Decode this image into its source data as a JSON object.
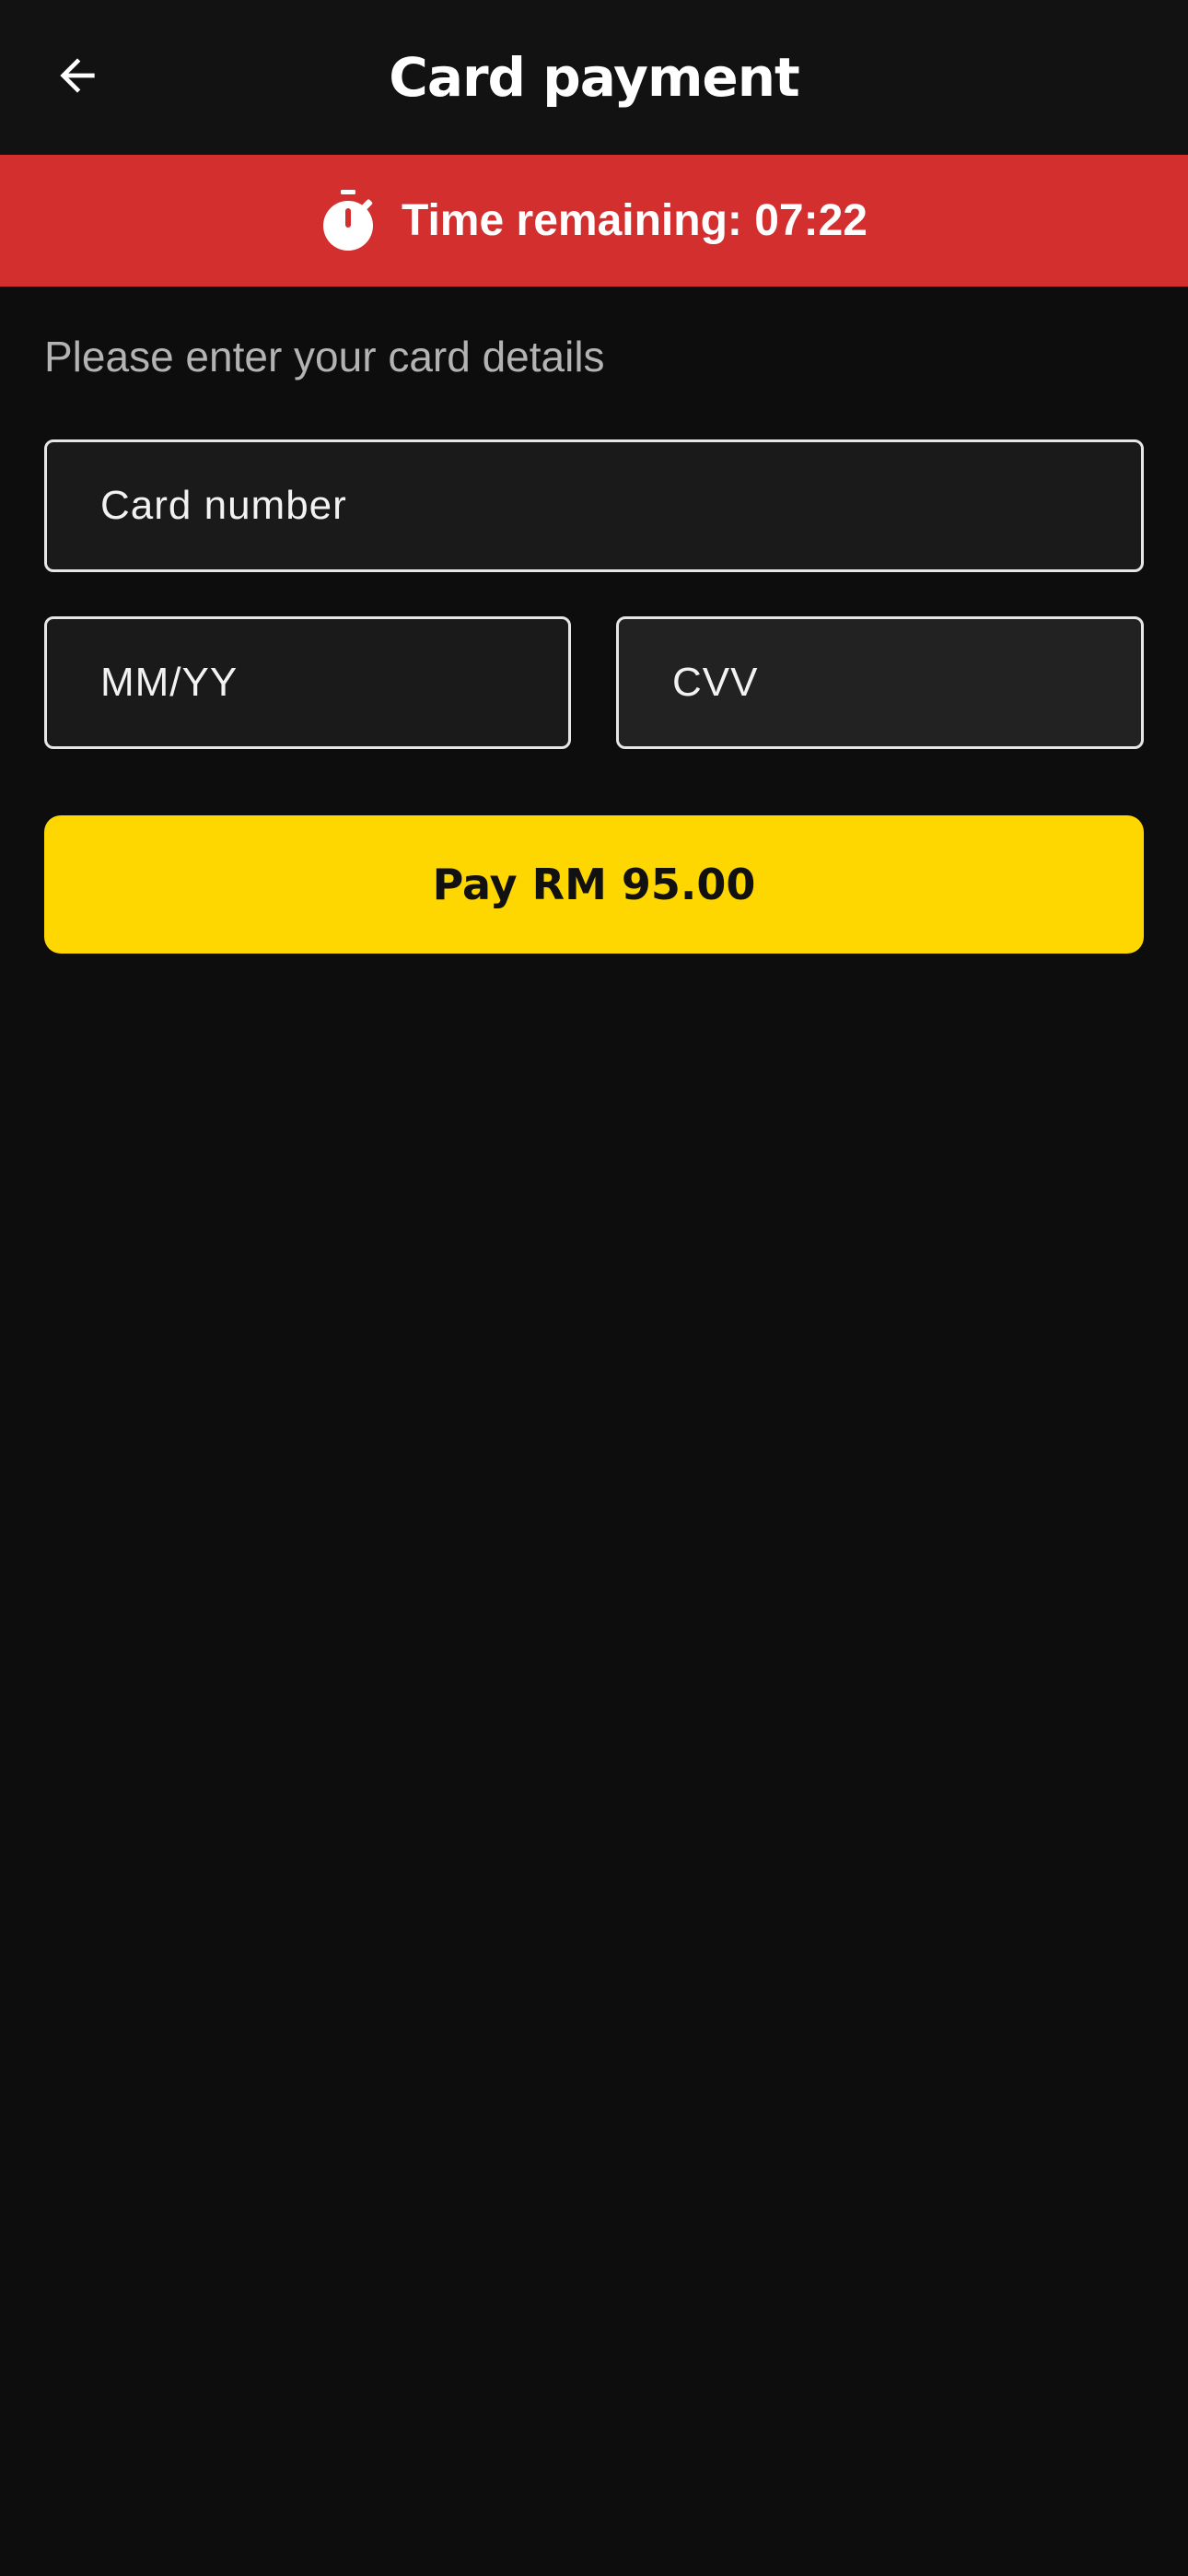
{
  "header": {
    "title": "Card payment",
    "back_icon": "arrow-left-icon"
  },
  "timer": {
    "icon": "stopwatch-icon",
    "text": "Time remaining: 07:22",
    "background": "#d32f2f"
  },
  "form": {
    "instructions": "Please enter your card details",
    "card_number_placeholder": "Card number",
    "expiry_placeholder": "MM/YY",
    "cvv_placeholder": "CVV",
    "pay_label": "Pay RM 95.00",
    "pay_color": "#ffd700"
  }
}
